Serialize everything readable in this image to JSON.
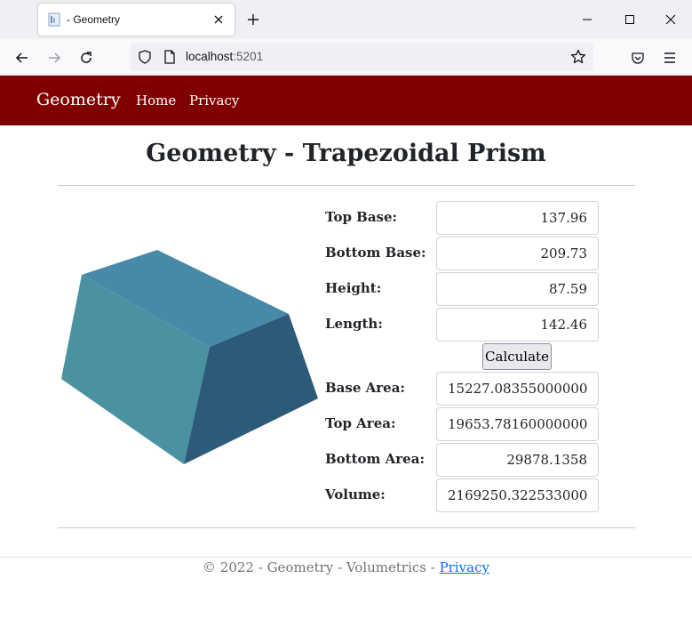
{
  "browser": {
    "tab_title": "- Geometry",
    "url_host": "localhost",
    "url_port": ":5201"
  },
  "site": {
    "brand": "Geometry",
    "nav": [
      "Home",
      "Privacy"
    ],
    "accent_color": "#800000"
  },
  "page": {
    "title": "Geometry - Trapezoidal Prism"
  },
  "inputs": {
    "top_base_label": "Top Base:",
    "top_base_value": "137.96",
    "bottom_base_label": "Bottom Base:",
    "bottom_base_value": "209.73",
    "height_label": "Height:",
    "height_value": "87.59",
    "length_label": "Length:",
    "length_value": "142.46"
  },
  "calculate_label": "Calculate",
  "results": {
    "base_area_label": "Base Area:",
    "base_area_value": "15227.083550000001",
    "top_area_label": "Top Area:",
    "top_area_value": "19653.781600000002",
    "bottom_area_label": "Bottom Area:",
    "bottom_area_value": "29878.1358",
    "volume_label": "Volume:",
    "volume_value": "2169250.3225330003"
  },
  "footer": {
    "text": "© 2022 - Geometry - Volumetrics - ",
    "link": "Privacy"
  }
}
